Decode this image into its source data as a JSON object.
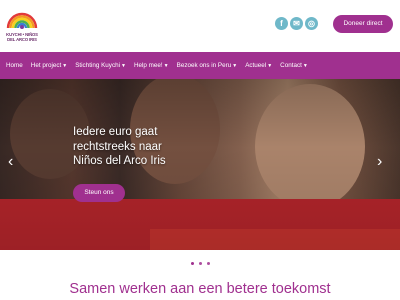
{
  "header": {
    "logo_text": "KUYCHI • NIÑOS DEL ARCO IRIS",
    "social": [
      {
        "name": "facebook-icon",
        "glyph": "f"
      },
      {
        "name": "mail-icon",
        "glyph": "✉"
      },
      {
        "name": "instagram-icon",
        "glyph": "◎"
      }
    ],
    "donate_label": "Doneer direct"
  },
  "nav": {
    "items": [
      {
        "label": "Home",
        "dropdown": false
      },
      {
        "label": "Het project",
        "dropdown": true
      },
      {
        "label": "Stichting Kuychi",
        "dropdown": true
      },
      {
        "label": "Help mee!",
        "dropdown": true
      },
      {
        "label": "Bezoek ons in Peru",
        "dropdown": true
      },
      {
        "label": "Actueel",
        "dropdown": true
      },
      {
        "label": "Contact",
        "dropdown": true
      }
    ]
  },
  "hero": {
    "line1": "Iedere euro gaat",
    "line2": "rechtstreeks naar",
    "line3": "Niños del Arco Iris",
    "button_label": "Steun ons",
    "prev_glyph": "‹",
    "next_glyph": "›"
  },
  "slider": {
    "dot_count": 3,
    "active_index": 0
  },
  "main": {
    "headline": "Samen werken aan een betere toekomst"
  },
  "colors": {
    "accent": "#a0308f",
    "social": "#6fb8c9"
  }
}
